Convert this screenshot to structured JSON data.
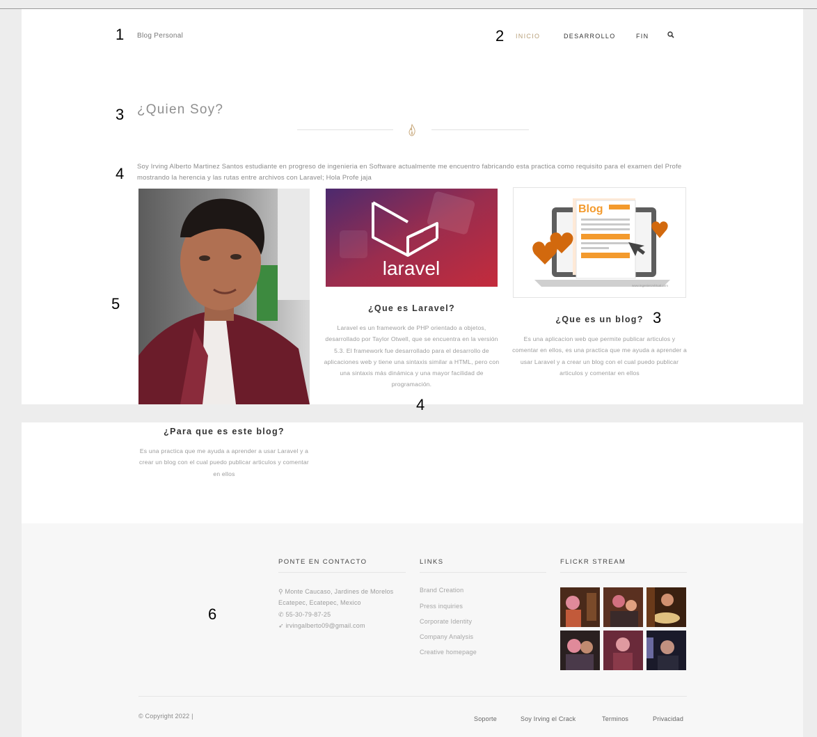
{
  "header": {
    "brand": "Blog Personal",
    "nav": [
      "INICIO",
      "DESARROLLO",
      "FIN"
    ]
  },
  "annotations": [
    "1",
    "2",
    "3",
    "4",
    "5",
    "3",
    "4",
    "6"
  ],
  "section": {
    "title": "¿Quien Soy?",
    "intro": "Soy Irving Alberto Martinez Santos estudiante en progreso de ingenieria en Software actualmente me encuentro fabricando esta practica como requisito para el examen del Profe mostrando la herencia y las rutas entre archivos con Laravel; Hola Profe jaja"
  },
  "cards": [
    {
      "title": "¿Para que es este blog?",
      "text": "Es una practica que me ayuda a aprender a usar Laravel y a crear un blog con el cual puedo publicar articulos y comentar en ellos"
    },
    {
      "title": "¿Que es Laravel?",
      "text": "Laravel es un framework de PHP orientado a objetos, desarrollado por Taylor Otwell, que se encuentra en la versión 5.3. El framework fue desarrollado para el desarrollo de aplicaciones web y tiene una sintaxis similar a HTML, pero con una sintaxis más dinámica y una mayor facilidad de programación.",
      "image_text": "laravel"
    },
    {
      "title": "¿Que es un blog?",
      "text": "Es una aplicacion web que permite publicar articulos y comentar en ellos, es una practica que me ayuda a aprender a usar Laravel y a crear un blog con el cual puedo publicar articulos y comentar en ellos",
      "image_text": "Blog",
      "image_caption": "www.IngenieroVirtual.com"
    }
  ],
  "footer": {
    "contact_heading": "PONTE EN CONTACTO",
    "address_1": "Monte Caucaso, Jardines de Morelos",
    "address_2": "Ecatepec, Ecatepec, Mexico",
    "phone": "55-30-79-87-25",
    "email": "irvingalberto09@gmail.com",
    "links_heading": "LINKS",
    "links": [
      "Brand Creation",
      "Press inquiries",
      "Corporate Identity",
      "Company Analysis",
      "Creative homepage"
    ],
    "flickr_heading": "FLICKR STREAM",
    "copyright": "© Copyright 2022 |",
    "legal": [
      "Soporte",
      "Soy Irving el Crack",
      "Terminos",
      "Privacidad"
    ]
  },
  "colors": {
    "accent": "#b8a07a",
    "laravel_red": "#b5284a",
    "blog_orange": "#f39a2d",
    "heart": "#d2690e"
  }
}
